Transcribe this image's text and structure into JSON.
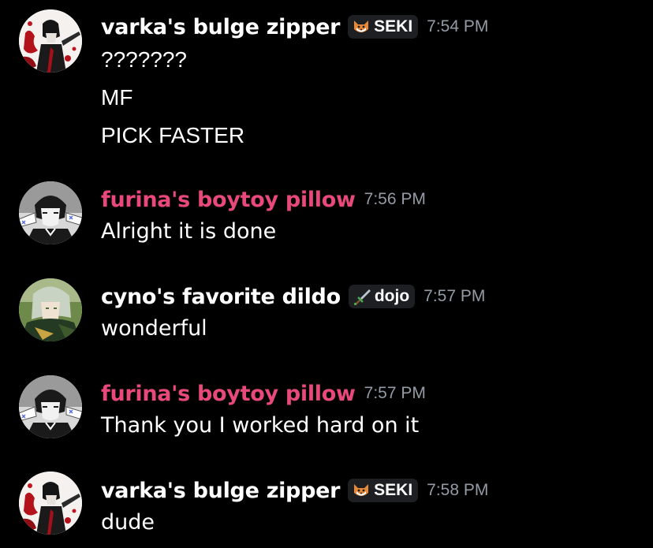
{
  "colors": {
    "background": "#000000",
    "default_username": "#ffffff",
    "pink_username": "#e8497a",
    "timestamp": "#949ba4",
    "tag_background": "#1e1f22"
  },
  "messages": [
    {
      "author": "varka's bulge zipper",
      "author_color": "#ffffff",
      "tag": {
        "icon": "fox-icon",
        "label": "SEKI"
      },
      "timestamp": "7:54 PM",
      "avatar": "red-splatter-avatar",
      "lines": [
        "???????",
        "MF",
        "PICK FASTER"
      ]
    },
    {
      "author": "furina's boytoy pillow",
      "author_color": "#e8497a",
      "tag": null,
      "timestamp": "7:56 PM",
      "avatar": "manga-boy-avatar",
      "lines": [
        "Alright it is done"
      ]
    },
    {
      "author": "cyno's favorite dildo",
      "author_color": "#ffffff",
      "tag": {
        "icon": "sword-icon",
        "label": "dojo"
      },
      "timestamp": "7:57 PM",
      "avatar": "green-haired-character-avatar",
      "lines": [
        "wonderful"
      ]
    },
    {
      "author": "furina's boytoy pillow",
      "author_color": "#e8497a",
      "tag": null,
      "timestamp": "7:57 PM",
      "avatar": "manga-boy-avatar",
      "lines": [
        "Thank you I worked hard on it"
      ]
    },
    {
      "author": "varka's bulge zipper",
      "author_color": "#ffffff",
      "tag": {
        "icon": "fox-icon",
        "label": "SEKI"
      },
      "timestamp": "7:58 PM",
      "avatar": "red-splatter-avatar",
      "lines": [
        "dude"
      ]
    }
  ]
}
